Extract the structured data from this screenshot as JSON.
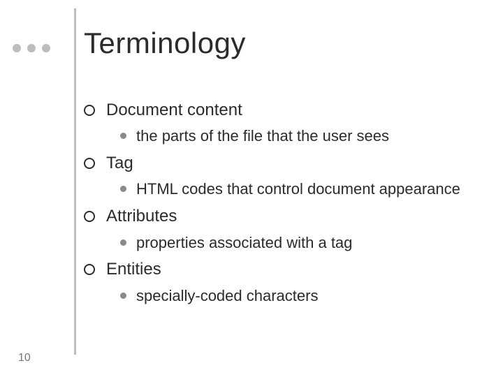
{
  "title": "Terminology",
  "page_number": "10",
  "items": [
    {
      "label": "Document content",
      "sub": "the parts of the file that the user sees"
    },
    {
      "label": "Tag",
      "sub": "HTML codes that control document appearance"
    },
    {
      "label": "Attributes",
      "sub": "properties associated with a tag"
    },
    {
      "label": "Entities",
      "sub": "specially-coded characters"
    }
  ]
}
